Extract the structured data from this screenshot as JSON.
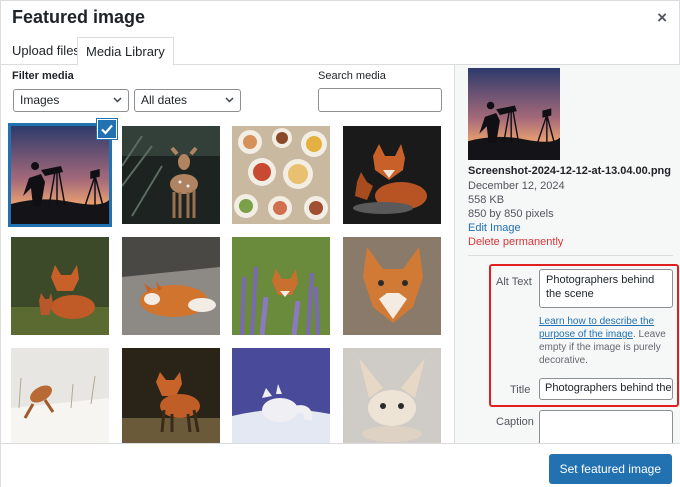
{
  "modal": {
    "title": "Featured image",
    "close_symbol": "×"
  },
  "tabs": [
    {
      "label": "Upload files"
    },
    {
      "label": "Media Library"
    }
  ],
  "filters": {
    "filter_label": "Filter media",
    "media_type": "Images",
    "dates": "All dates",
    "search_label": "Search media",
    "search_value": ""
  },
  "grid": {
    "items": [
      {
        "icon": "photographers-thumbnail",
        "selected": true
      },
      {
        "icon": "deer-thumbnail"
      },
      {
        "icon": "food-table-thumbnail"
      },
      {
        "icon": "fox-pair-thumbnail"
      },
      {
        "icon": "fox-with-cubs-thumbnail"
      },
      {
        "icon": "sleeping-fox-thumbnail"
      },
      {
        "icon": "fox-in-flowers-thumbnail"
      },
      {
        "icon": "fox-portrait-thumbnail"
      },
      {
        "icon": "fox-jumping-snow-thumbnail"
      },
      {
        "icon": "fox-walking-thumbnail"
      },
      {
        "icon": "arctic-fox-thumbnail"
      },
      {
        "icon": "fennec-fox-thumbnail"
      }
    ]
  },
  "details": {
    "filename": "Screenshot-2024-12-12-at-13.04.00.png",
    "date": "December 12, 2024",
    "size": "558 KB",
    "dimensions": "850 by 850 pixels",
    "edit_link": "Edit Image",
    "delete_link": "Delete permanently",
    "alt_label": "Alt Text",
    "alt_value": "Photographers behind the scene",
    "help_link": "Learn how to describe the purpose of the image",
    "help_rest": ". Leave empty if the image is purely decorative.",
    "title_label": "Title",
    "title_value": "Photographers behind the",
    "caption_label": "Caption",
    "caption_value": ""
  },
  "footer": {
    "button_label": "Set featured image"
  },
  "colors": {
    "accent": "#2271b1",
    "highlight": "#e02020",
    "danger": "#d63638"
  }
}
